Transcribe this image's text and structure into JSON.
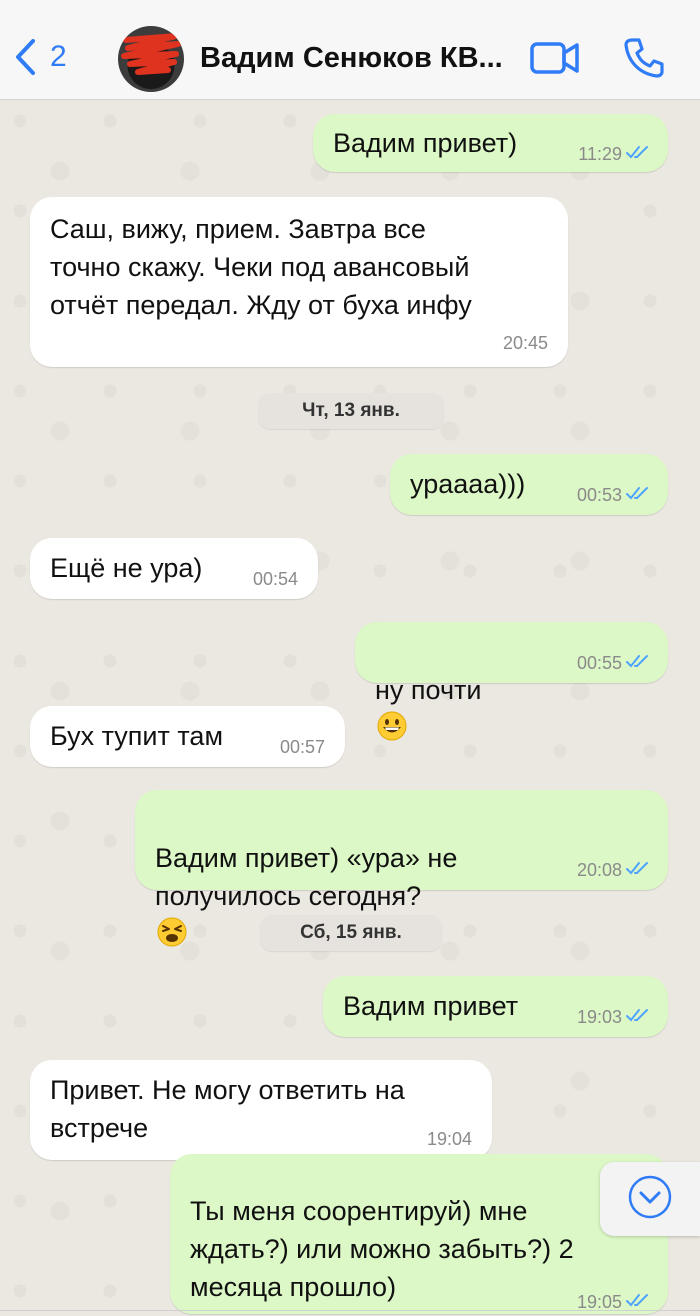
{
  "header": {
    "back_count": "2",
    "contact_name": "Вадим Сенюков КВ...",
    "video_icon": "video-camera-icon",
    "call_icon": "phone-icon"
  },
  "colors": {
    "accent": "#2f7cf6",
    "outgoing_bubble": "#dcf8c6",
    "incoming_bubble": "#ffffff",
    "read_ticks": "#4fa3ff"
  },
  "messages": [
    {
      "direction": "out",
      "text": "Вадим привет)",
      "time": "11:29",
      "status": "read"
    },
    {
      "direction": "in",
      "text": "Саш, вижу, прием. Завтра все\nточно скажу. Чеки под авансовый\nотчёт передал. Жду от буха инфу",
      "time": "20:45"
    },
    {
      "date": "Чт, 13 янв."
    },
    {
      "direction": "out",
      "text": "урaaaa)))",
      "time": "00:53",
      "status": "read"
    },
    {
      "direction": "in",
      "text": "Ещё не ура)",
      "time": "00:54"
    },
    {
      "direction": "out",
      "text": "ну почти",
      "emoji": "grinning-face",
      "time": "00:55",
      "status": "read"
    },
    {
      "direction": "in",
      "text": "Бух тупит там",
      "time": "00:57"
    },
    {
      "direction": "out",
      "text": "Вадим привет) «ура» не\nполучилось сегодня?",
      "emoji": "tired-face",
      "time": "20:08",
      "status": "read"
    },
    {
      "date": "Сб, 15 янв."
    },
    {
      "direction": "out",
      "text": "Вадим привет",
      "time": "19:03",
      "status": "read"
    },
    {
      "direction": "in",
      "text": "Привет. Не могу ответить на\nвстрече",
      "time": "19:04"
    },
    {
      "direction": "out",
      "text": "Ты меня соорентируй) мне\nждать?) или можно забыть?) 2\nмесяца прошло)",
      "time": "19:05",
      "status": "read"
    }
  ],
  "scroll_down_icon": "chevron-down-circle-icon"
}
